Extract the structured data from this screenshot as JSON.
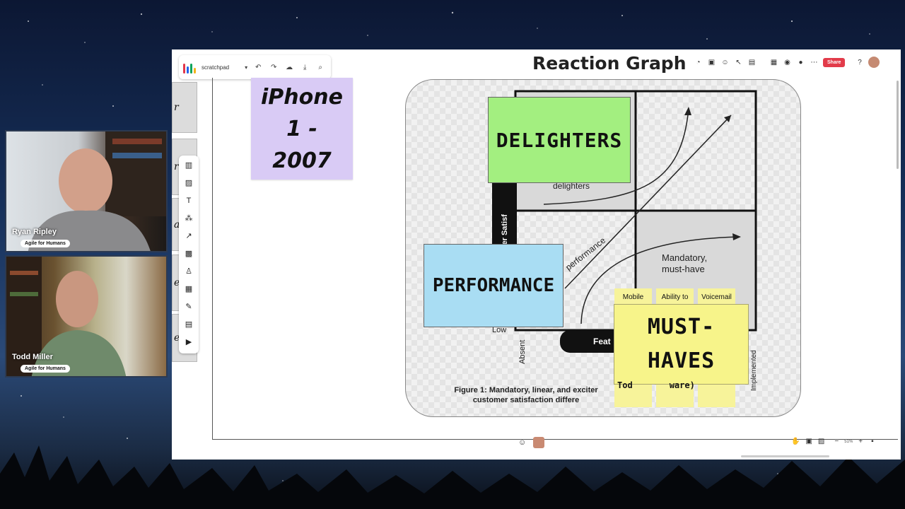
{
  "board": {
    "name": "scratchpad",
    "title": "Reaction Graph",
    "share_label": "Share",
    "zoom_level": "51%"
  },
  "sidebar_cards": [
    "r",
    "r",
    "a",
    "e",
    "e"
  ],
  "stickies": {
    "iphone": "iPhone 1 - 2007",
    "delighters": "DELIGHTERS",
    "performance": "PERFORMANCE",
    "must_haves": "MUST-HAVES",
    "mini": [
      "Mobile",
      "Ability to",
      "Voicemail"
    ]
  },
  "graph": {
    "label_delighters": "delighters",
    "label_performance": "performance",
    "label_mandatory_1": "Mandatory,",
    "label_mandatory_2": "must-have",
    "label_low": "Low",
    "label_absent": "Absent",
    "label_implemented": "Implemented",
    "label_satisfaction": "omer Satisf",
    "label_feat": "Feat",
    "mini_bottom": [
      "Tod",
      "",
      "ware)"
    ],
    "caption_line1": "Figure 1: Mandatory, linear, and exciter",
    "caption_line2": "customer satisfaction differe"
  },
  "participants": [
    {
      "name": "Ryan Ripley",
      "org": "Agile for Humans"
    },
    {
      "name": "Todd Miller",
      "org": "Agile for Humans"
    }
  ],
  "colors": {
    "share": "#e23b4a",
    "delighters": "#a3ef80",
    "performance": "#a9ddf3",
    "must_haves": "#f7f48a",
    "iphone": "#d9cbf5"
  }
}
